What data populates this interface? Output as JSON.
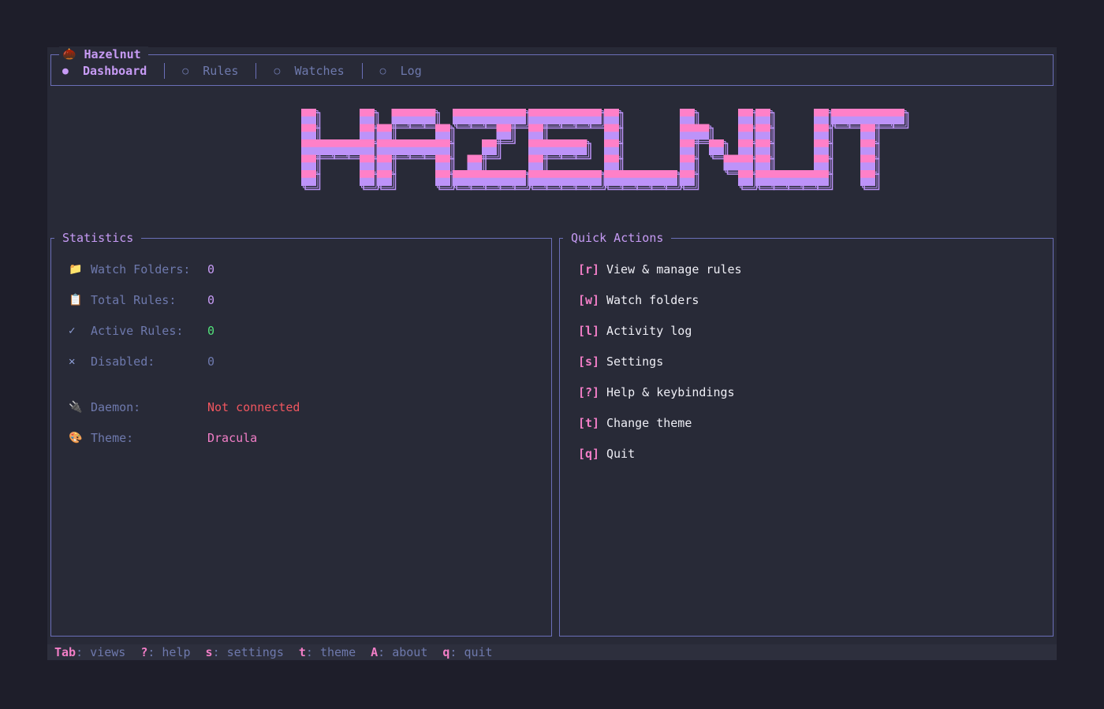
{
  "app": {
    "title": "Hazelnut",
    "icon": "acorn-icon"
  },
  "tabs": [
    {
      "label": "Dashboard",
      "active": true
    },
    {
      "label": "Rules",
      "active": false
    },
    {
      "label": "Watches",
      "active": false
    },
    {
      "label": "Log",
      "active": false
    }
  ],
  "logo": {
    "text": "HAZELNUT",
    "colors": [
      "#ff80c8",
      "#bd93f9"
    ]
  },
  "statistics": {
    "title": "Statistics",
    "watch_folders": {
      "icon": "folder-icon",
      "label": "Watch Folders:",
      "value": "0"
    },
    "total_rules": {
      "icon": "clipboard-icon",
      "label": "Total Rules:",
      "value": "0"
    },
    "active_rules": {
      "icon": "check-icon",
      "label": "Active Rules:",
      "value": "0"
    },
    "disabled": {
      "icon": "cross-icon",
      "label": "Disabled:",
      "value": "0"
    },
    "daemon": {
      "icon": "plug-icon",
      "label": "Daemon:",
      "value": "Not connected"
    },
    "theme": {
      "icon": "palette-icon",
      "label": "Theme:",
      "value": "Dracula"
    }
  },
  "quick_actions": {
    "title": "Quick Actions",
    "items": [
      {
        "key": "[r]",
        "label": "View & manage rules"
      },
      {
        "key": "[w]",
        "label": "Watch folders"
      },
      {
        "key": "[l]",
        "label": "Activity log"
      },
      {
        "key": "[s]",
        "label": "Settings"
      },
      {
        "key": "[?]",
        "label": "Help & keybindings"
      },
      {
        "key": "[t]",
        "label": "Change theme"
      },
      {
        "key": "[q]",
        "label": "Quit"
      }
    ]
  },
  "footer": {
    "hints": [
      {
        "key": "Tab",
        "desc": ": views"
      },
      {
        "key": "?",
        "desc": ": help"
      },
      {
        "key": "s",
        "desc": ": settings"
      },
      {
        "key": "t",
        "desc": ": theme"
      },
      {
        "key": "A",
        "desc": ": about"
      },
      {
        "key": "q",
        "desc": ": quit"
      }
    ]
  },
  "colors": {
    "background": "#282a37",
    "border": "#6b6fb8",
    "accent_purple": "#c79bf5",
    "accent_pink": "#f27ec7",
    "muted": "#6e79ad",
    "error": "#f0565f",
    "success": "#52e07a"
  }
}
